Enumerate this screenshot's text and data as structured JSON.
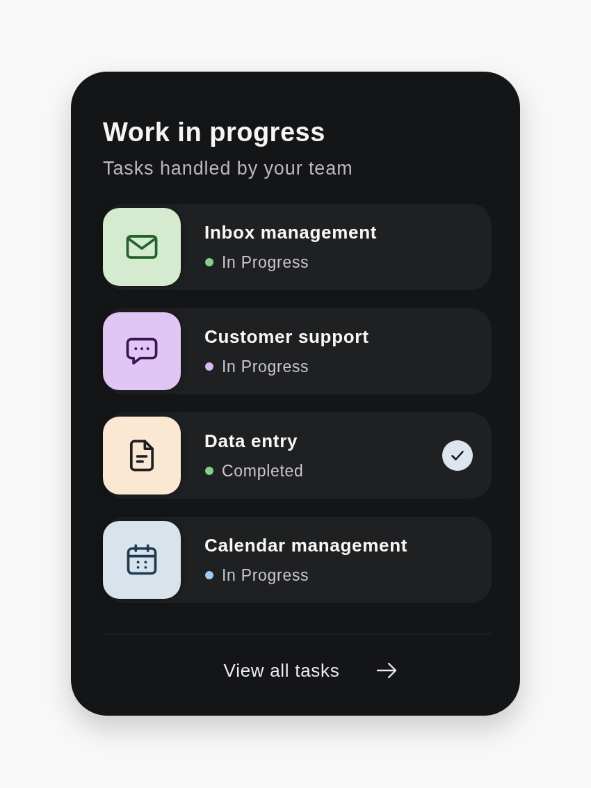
{
  "card": {
    "title": "Work in progress",
    "subtitle": "Tasks handled by your team"
  },
  "tasks": [
    {
      "kind": "mail",
      "name": "Inbox management",
      "status": "In Progress",
      "color": "#86d18a",
      "completed": false
    },
    {
      "kind": "chat",
      "name": "Customer support",
      "status": "In Progress",
      "color": "#dcb6f2",
      "completed": false
    },
    {
      "kind": "document",
      "name": "Data entry",
      "status": "Completed",
      "color": "#86d18a",
      "completed": true
    },
    {
      "kind": "calendar",
      "name": "Calendar management",
      "status": "In Progress",
      "color": "#9fcbf3",
      "completed": false
    }
  ],
  "footer": {
    "link": "View all tasks"
  }
}
